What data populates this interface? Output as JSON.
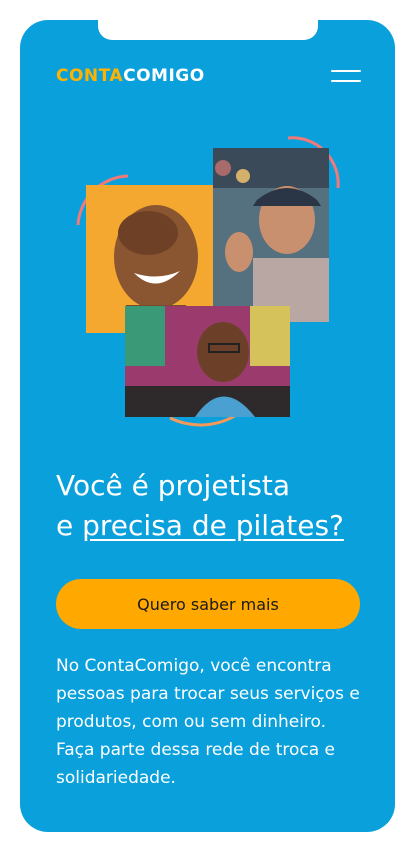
{
  "header": {
    "logo_part1": "CONTA",
    "logo_part2": "COMIGO",
    "menu_icon": "hamburger-menu-icon"
  },
  "hero": {
    "title_line1": "Você é projetista",
    "title_prefix": "e ",
    "title_link": "precisa de pilates?",
    "cta_label": "Quero saber mais",
    "description": "No ContaComigo, você encontra pessoas para trocar seus serviços e produtos, com ou sem dinheiro. Faça parte dessa rede de troca e solidariedade."
  },
  "colors": {
    "background": "#0aa0dc",
    "accent": "#ffa800",
    "text": "#ffffff",
    "arc": "#f07a78"
  }
}
